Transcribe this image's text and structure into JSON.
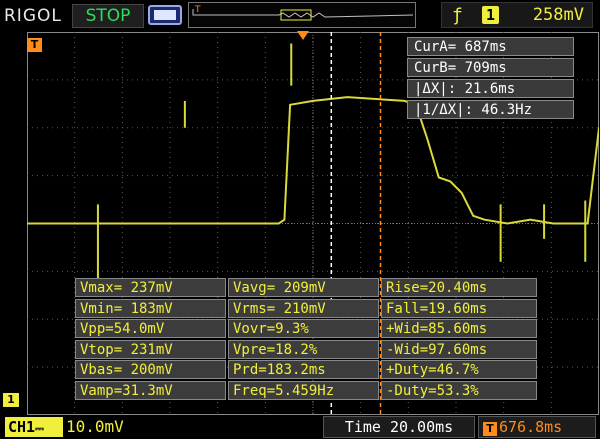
{
  "header": {
    "brand": "RIGOL",
    "run_state": "STOP",
    "trigger_channel": "1",
    "trigger_level": "258mV"
  },
  "markers": {
    "trigger_pos": "T",
    "channel1": "1",
    "trigger_icon": "T"
  },
  "cursors": [
    "CurA= 687ms",
    "CurB= 709ms",
    "|ΔX|: 21.6ms",
    "|1/ΔX|: 46.3Hz"
  ],
  "measurements": [
    [
      "Vmax= 237mV",
      "Vavg= 209mV",
      "Rise=20.40ms"
    ],
    [
      "Vmin= 183mV",
      "Vrms= 210mV",
      "Fall=19.60ms"
    ],
    [
      "Vpp=54.0mV",
      "Vovr=9.3%",
      "+Wid=85.60ms"
    ],
    [
      "Vtop= 231mV",
      "Vpre=18.2%",
      "-Wid=97.60ms"
    ],
    [
      "Vbas= 200mV",
      "Prd=183.2ms",
      "+Duty=46.7%"
    ],
    [
      "Vamp=31.3mV",
      "Freq=5.459Hz",
      "-Duty=53.3%"
    ]
  ],
  "footer": {
    "channel_label": "CH1",
    "channel_scale": "10.0mV",
    "timebase": "Time 20.00ms",
    "trigger_offset": "676.8ms"
  },
  "colors": {
    "trace": "#d9d93a",
    "accent": "#f1ef3d",
    "orange": "#ff8c1a",
    "stop_green": "#27e15a"
  },
  "waveform": {
    "x_unit": "ms",
    "y_unit": "mV",
    "points": [
      [
        0,
        200
      ],
      [
        22,
        200
      ],
      [
        22.5,
        201
      ],
      [
        23,
        231
      ],
      [
        25,
        232
      ],
      [
        28,
        233
      ],
      [
        33,
        232
      ],
      [
        34,
        231
      ],
      [
        35,
        222
      ],
      [
        36,
        212
      ],
      [
        37,
        211
      ],
      [
        38,
        208
      ],
      [
        39,
        202
      ],
      [
        40,
        201
      ],
      [
        42,
        200
      ],
      [
        44,
        201
      ],
      [
        46,
        200
      ],
      [
        49,
        200
      ],
      [
        50,
        225
      ]
    ]
  }
}
